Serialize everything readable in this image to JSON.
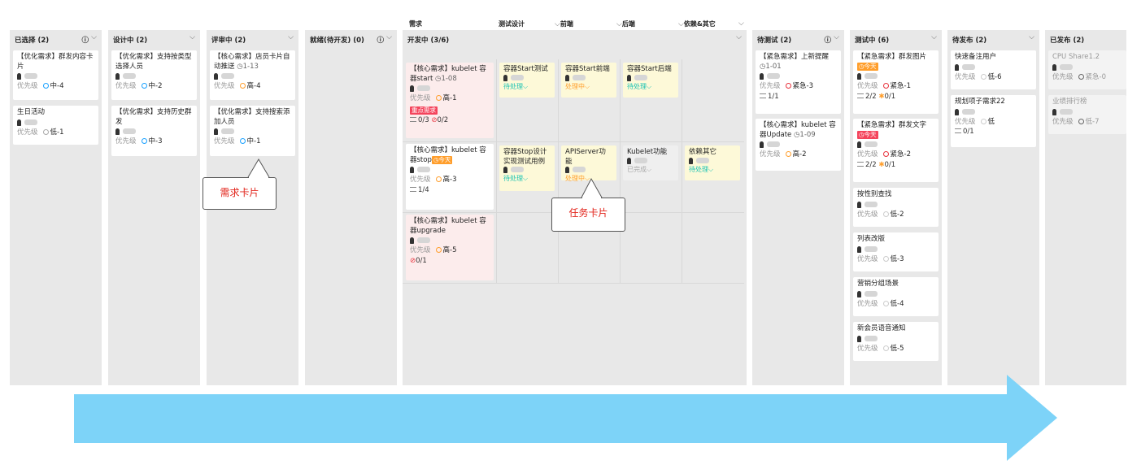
{
  "columns": [
    {
      "title": "已选择 (2)",
      "info": true
    },
    {
      "title": "设计中 (2)",
      "info": false
    },
    {
      "title": "评审中 (2)",
      "info": false
    },
    {
      "title": "就绪(待开发) (0)",
      "info": true
    },
    {
      "title": "开发中 (3/6)",
      "info": false
    },
    {
      "title": "待测试 (2)",
      "info": true
    },
    {
      "title": "测试中 (6)",
      "info": false
    },
    {
      "title": "待发布 (2)",
      "info": false
    },
    {
      "title": "已发布 (2)",
      "info": false
    }
  ],
  "dev_sub": [
    "需求",
    "测试设计",
    "前端",
    "后端",
    "依赖&其它"
  ],
  "priority_label": "优先级",
  "cards": {
    "c1a": {
      "title": "【优化需求】群发内容卡片",
      "pri": "中-4"
    },
    "c1b": {
      "title": "生日活动",
      "pri": "低-1"
    },
    "c2a": {
      "title": "【优化需求】支持按类型选择人员",
      "pri": "中-2"
    },
    "c2b": {
      "title": "【优化需求】支持历史群发",
      "pri": "中-3"
    },
    "c3a": {
      "title": "【核心需求】店员卡片自动推送",
      "date": "1-13",
      "pri": "高-4"
    },
    "c3b": {
      "title": "【优化需求】支持搜索添加人员",
      "pri": "中-1"
    },
    "d1": {
      "title": "【核心需求】kubelet 容器start",
      "date": "1-08",
      "pri": "高-1",
      "tag": "重点需求",
      "meta1": "0/3",
      "meta2": "0/2"
    },
    "d2": {
      "title": "【核心需求】kubelet 容器stop",
      "tag": "今天",
      "pri": "高-3",
      "meta1": "1/4"
    },
    "d3": {
      "title": "【核心需求】kubelet 容器upgrade",
      "pri": "高-5",
      "meta2": "0/1"
    },
    "t1": {
      "title": "容器Start测试",
      "status": "待处理"
    },
    "t2": {
      "title": "容器Start前端",
      "status": "处理中"
    },
    "t3": {
      "title": "容器Start后端",
      "status": "待处理"
    },
    "t4": {
      "title": "容器Stop设计实现测试用例",
      "status": "待处理"
    },
    "t5": {
      "title": "APIServer功能",
      "status": "处理中"
    },
    "t6": {
      "title": "Kubelet功能",
      "status": "已完成"
    },
    "t7": {
      "title": "依赖其它",
      "status": "待处理"
    },
    "p1": {
      "title": "【紧急需求】上新提醒",
      "date": "1-01",
      "pri": "紧急-3",
      "meta1": "1/1"
    },
    "p2": {
      "title": "【核心需求】kubelet 容器Update",
      "date": "1-09",
      "pri": "高-2"
    },
    "q1": {
      "title": "【紧急需求】群发图片",
      "tag": "今天",
      "pri": "紧急-1",
      "meta1": "2/2",
      "meta2": "0/1"
    },
    "q2": {
      "title": "【紧急需求】群发文字",
      "tag": "今天",
      "pri": "紧急-2",
      "meta1": "2/2",
      "meta2": "0/1"
    },
    "q3": {
      "title": "按性别查找",
      "pri": "低-2"
    },
    "q4": {
      "title": "列表改版",
      "pri": "低-3"
    },
    "q5": {
      "title": "营销分组场景",
      "pri": "低-4"
    },
    "q6": {
      "title": "新会员语音通知",
      "pri": "低-5"
    },
    "r1": {
      "title": "快速备注用户",
      "pri": "低-6"
    },
    "r2": {
      "title": "规划项子需求22",
      "pri": "低",
      "meta1": "0/1"
    },
    "s1": {
      "title": "CPU Share1.2",
      "pri": "紧急-0"
    },
    "s2": {
      "title": "业绩排行榜",
      "pri": "低-7"
    }
  },
  "callouts": {
    "req": "需求卡片",
    "task": "任务卡片"
  },
  "colors": {
    "arrow": "#7dd3f8",
    "high": "#ff9e2c",
    "mid": "#18a0ff",
    "low": "#aaaaaa",
    "urgent": "#e8323c",
    "callout_text": "#e2231a"
  }
}
